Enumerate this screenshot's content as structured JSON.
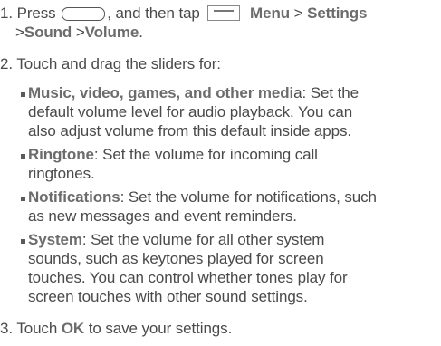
{
  "steps": [
    {
      "number": "1.",
      "part1": "Press",
      "button_icon": "home-key-icon",
      "part2": ", and then tap",
      "menu_icon": "menu-icon",
      "menu_label": "Menu",
      "sep": ">",
      "settings": "Settings",
      "sound": "Sound",
      "volume": "Volume",
      "end": "."
    },
    {
      "number": "2.",
      "text": "Touch and drag the sliders for:"
    },
    {
      "number": "3.",
      "text_pre": "Touch",
      "ok": "OK",
      "text_post": "to save your settings."
    }
  ],
  "bullets": [
    {
      "term": "Music, video, games, and other medi",
      "term_tail": "a",
      "lines": [
        ": Set the",
        "default volume level for audio playback. You can",
        "also adjust volume from this default inside apps."
      ]
    },
    {
      "term": "Ringtone",
      "lines": [
        ": Set the volume for incoming call",
        "ringtones."
      ]
    },
    {
      "term": "Notifications",
      "lines": [
        ": Set the volume for notifications, such",
        "as new messages and event reminders."
      ]
    },
    {
      "term": "System",
      "lines": [
        ": Set the volume for all other system",
        "sounds, such as keytones played for screen",
        "touches. You can control whether tones play for",
        "screen touches with other sound settings."
      ]
    }
  ]
}
